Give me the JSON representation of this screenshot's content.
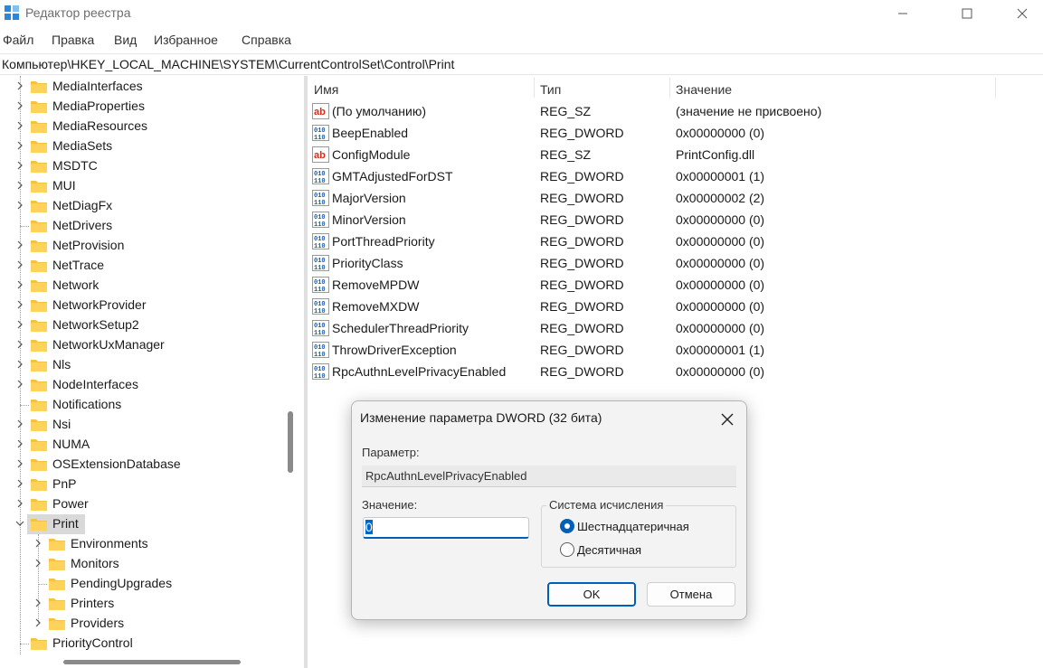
{
  "window": {
    "title": "Редактор реестра"
  },
  "menu": [
    "Файл",
    "Правка",
    "Вид",
    "Избранное",
    "Справка"
  ],
  "address": "Компьютер\\HKEY_LOCAL_MACHINE\\SYSTEM\\CurrentControlSet\\Control\\Print",
  "tree": {
    "items": [
      {
        "label": "MediaInterfaces",
        "expandable": true
      },
      {
        "label": "MediaProperties",
        "expandable": true
      },
      {
        "label": "MediaResources",
        "expandable": true
      },
      {
        "label": "MediaSets",
        "expandable": true
      },
      {
        "label": "MSDTC",
        "expandable": true
      },
      {
        "label": "MUI",
        "expandable": true
      },
      {
        "label": "NetDiagFx",
        "expandable": true
      },
      {
        "label": "NetDrivers",
        "expandable": false
      },
      {
        "label": "NetProvision",
        "expandable": true
      },
      {
        "label": "NetTrace",
        "expandable": true
      },
      {
        "label": "Network",
        "expandable": true
      },
      {
        "label": "NetworkProvider",
        "expandable": true
      },
      {
        "label": "NetworkSetup2",
        "expandable": true
      },
      {
        "label": "NetworkUxManager",
        "expandable": true
      },
      {
        "label": "Nls",
        "expandable": true
      },
      {
        "label": "NodeInterfaces",
        "expandable": true
      },
      {
        "label": "Notifications",
        "expandable": false
      },
      {
        "label": "Nsi",
        "expandable": true
      },
      {
        "label": "NUMA",
        "expandable": true
      },
      {
        "label": "OSExtensionDatabase",
        "expandable": true
      },
      {
        "label": "PnP",
        "expandable": true
      },
      {
        "label": "Power",
        "expandable": true
      },
      {
        "label": "Print",
        "expandable": true,
        "expanded": true,
        "selected": true
      },
      {
        "label": "Environments",
        "expandable": true,
        "child": true
      },
      {
        "label": "Monitors",
        "expandable": true,
        "child": true
      },
      {
        "label": "PendingUpgrades",
        "expandable": false,
        "child": true
      },
      {
        "label": "Printers",
        "expandable": true,
        "child": true
      },
      {
        "label": "Providers",
        "expandable": true,
        "child": true
      },
      {
        "label": "PriorityControl",
        "expandable": false
      }
    ]
  },
  "list": {
    "columns": [
      "Имя",
      "Тип",
      "Значение"
    ],
    "rows": [
      {
        "name": "(По умолчанию)",
        "type": "REG_SZ",
        "value": "(значение не присвоено)",
        "icon": "string-value-icon"
      },
      {
        "name": "BeepEnabled",
        "type": "REG_DWORD",
        "value": "0x00000000 (0)",
        "icon": "binary-value-icon"
      },
      {
        "name": "ConfigModule",
        "type": "REG_SZ",
        "value": "PrintConfig.dll",
        "icon": "string-value-icon"
      },
      {
        "name": "GMTAdjustedForDST",
        "type": "REG_DWORD",
        "value": "0x00000001 (1)",
        "icon": "binary-value-icon"
      },
      {
        "name": "MajorVersion",
        "type": "REG_DWORD",
        "value": "0x00000002 (2)",
        "icon": "binary-value-icon"
      },
      {
        "name": "MinorVersion",
        "type": "REG_DWORD",
        "value": "0x00000000 (0)",
        "icon": "binary-value-icon"
      },
      {
        "name": "PortThreadPriority",
        "type": "REG_DWORD",
        "value": "0x00000000 (0)",
        "icon": "binary-value-icon"
      },
      {
        "name": "PriorityClass",
        "type": "REG_DWORD",
        "value": "0x00000000 (0)",
        "icon": "binary-value-icon"
      },
      {
        "name": "RemoveMPDW",
        "type": "REG_DWORD",
        "value": "0x00000000 (0)",
        "icon": "binary-value-icon"
      },
      {
        "name": "RemoveMXDW",
        "type": "REG_DWORD",
        "value": "0x00000000 (0)",
        "icon": "binary-value-icon"
      },
      {
        "name": "SchedulerThreadPriority",
        "type": "REG_DWORD",
        "value": "0x00000000 (0)",
        "icon": "binary-value-icon"
      },
      {
        "name": "ThrowDriverException",
        "type": "REG_DWORD",
        "value": "0x00000001 (1)",
        "icon": "binary-value-icon"
      },
      {
        "name": "RpcAuthnLevelPrivacyEnabled",
        "type": "REG_DWORD",
        "value": "0x00000000 (0)",
        "icon": "binary-value-icon"
      }
    ]
  },
  "dialog": {
    "title": "Изменение параметра DWORD (32 бита)",
    "param_label": "Параметр:",
    "param_value": "RpcAuthnLevelPrivacyEnabled",
    "value_label": "Значение:",
    "value": "0",
    "base_group_label": "Система исчисления",
    "radio_hex": "Шестнадцатеричная",
    "radio_dec": "Десятичная",
    "selected_base": "hex",
    "ok_label": "OK",
    "cancel_label": "Отмена"
  },
  "colors": {
    "accent": "#005fb8",
    "folder": "#f5c344",
    "selection": "#d9d9d9"
  }
}
